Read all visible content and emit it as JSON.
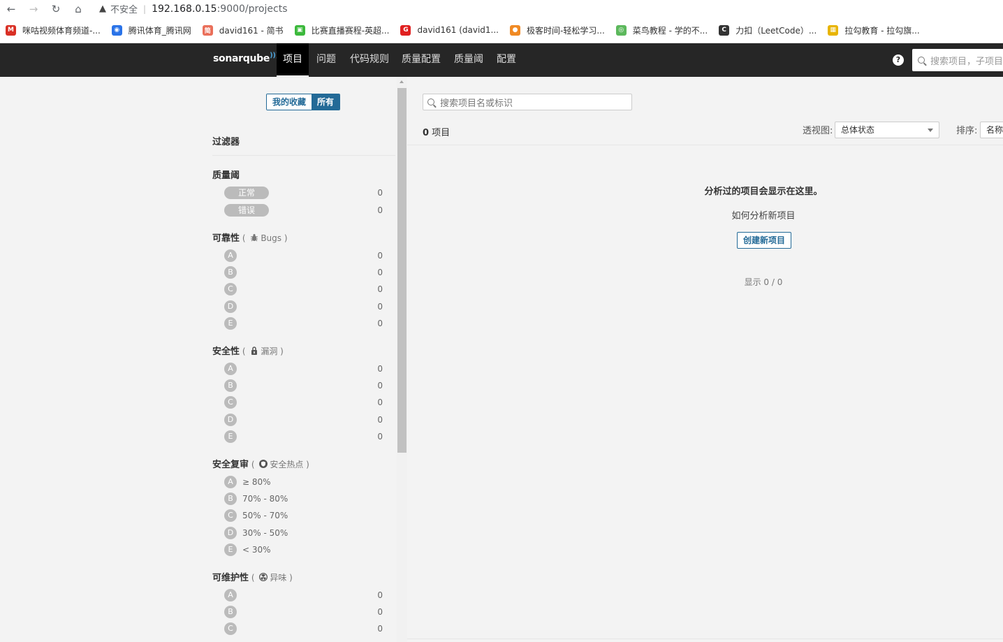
{
  "browser": {
    "insecure_label": "不安全",
    "url_host": "192.168.0.15",
    "url_path": ":9000/projects",
    "bookmarks": [
      {
        "label": "咪咕视频体育频道-...",
        "color": "#d93025",
        "glyph": "M"
      },
      {
        "label": "腾讯体育_腾讯网",
        "color": "#2a73e8",
        "glyph": "◉"
      },
      {
        "label": "david161 - 简书",
        "color": "#ea6f5a",
        "glyph": "简"
      },
      {
        "label": "比赛直播赛程-英超...",
        "color": "#3cb93c",
        "glyph": "▣"
      },
      {
        "label": "david161 (david1...",
        "color": "#e02020",
        "glyph": "G"
      },
      {
        "label": "极客时间-轻松学习...",
        "color": "#f08a24",
        "glyph": "●"
      },
      {
        "label": "菜鸟教程 - 学的不...",
        "color": "#5cb85c",
        "glyph": "◎"
      },
      {
        "label": "力扣（LeetCode）...",
        "color": "#333333",
        "glyph": "C"
      },
      {
        "label": "拉勾教育 - 拉勾旗...",
        "color": "#e8b400",
        "glyph": "▦"
      }
    ]
  },
  "nav": {
    "logo_text": "sonarqube",
    "items": [
      "项目",
      "问题",
      "代码规则",
      "质量配置",
      "质量阈",
      "配置"
    ],
    "search_placeholder": "搜索项目，子项目和文件",
    "help": "?"
  },
  "sidebar": {
    "toggle_favorites": "我的收藏",
    "toggle_all": "所有",
    "filters_title": "过滤器",
    "quality_gate": {
      "title": "质量阈",
      "options": [
        {
          "label": "正常",
          "count": "0"
        },
        {
          "label": "错误",
          "count": "0"
        }
      ]
    },
    "reliability": {
      "title": "可靠性",
      "sub": "Bugs",
      "ratings": [
        {
          "r": "A",
          "count": "0"
        },
        {
          "r": "B",
          "count": "0"
        },
        {
          "r": "C",
          "count": "0"
        },
        {
          "r": "D",
          "count": "0"
        },
        {
          "r": "E",
          "count": "0"
        }
      ]
    },
    "security": {
      "title": "安全性",
      "sub": "漏洞",
      "ratings": [
        {
          "r": "A",
          "count": "0"
        },
        {
          "r": "B",
          "count": "0"
        },
        {
          "r": "C",
          "count": "0"
        },
        {
          "r": "D",
          "count": "0"
        },
        {
          "r": "E",
          "count": "0"
        }
      ]
    },
    "security_review": {
      "title": "安全复审",
      "sub": "安全热点",
      "ratings": [
        {
          "r": "A",
          "range": "≥ 80%"
        },
        {
          "r": "B",
          "range": "70% - 80%"
        },
        {
          "r": "C",
          "range": "50% - 70%"
        },
        {
          "r": "D",
          "range": "30% - 50%"
        },
        {
          "r": "E",
          "range": "< 30%"
        }
      ]
    },
    "maintainability": {
      "title": "可维护性",
      "sub": "异味",
      "ratings": [
        {
          "r": "A",
          "count": "0"
        },
        {
          "r": "B",
          "count": "0"
        },
        {
          "r": "C",
          "count": "0"
        }
      ]
    }
  },
  "main": {
    "search_placeholder": "搜索项目名或标识",
    "project_count": "0",
    "project_count_suffix": " 项目",
    "view_label": "透视图:",
    "view_value": "总体状态",
    "sort_label": "排序:",
    "sort_value": "名称",
    "empty_title": "分析过的项目会显示在这里。",
    "empty_howto": "如何分析新项目",
    "create_button": "创建新项目",
    "showing": "显示 0 / 0"
  }
}
